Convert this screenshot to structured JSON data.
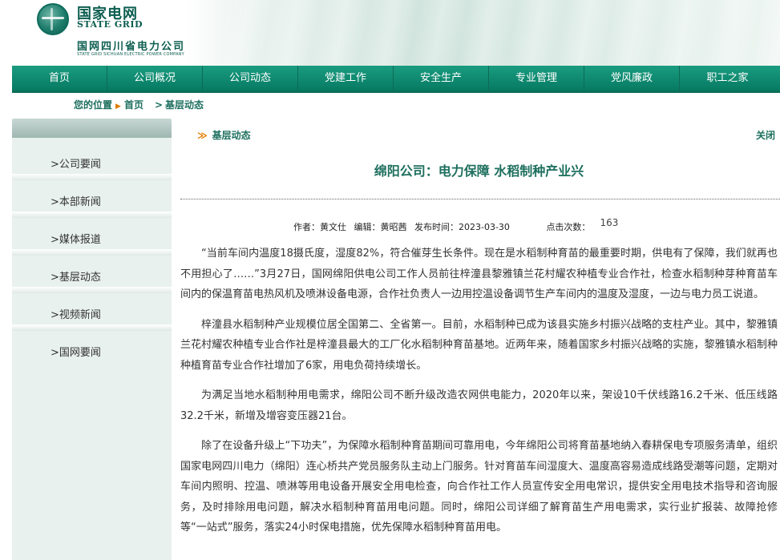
{
  "header": {
    "logo_cn": "国家电网",
    "logo_en": "STATE GRID",
    "company_name": "国网四川省电力公司",
    "company_en": "STATE GRID SICHUAN ELECTRIC POWER COMPANY"
  },
  "nav": [
    "首页",
    "公司概况",
    "公司动态",
    "党建工作",
    "安全生产",
    "专业管理",
    "党风廉政",
    "职工之家"
  ],
  "breadcrumb": {
    "label": "您的位置",
    "home": "首页",
    "current": "基层动态"
  },
  "sidebar": [
    "公司要闻",
    "本部新闻",
    "媒体报道",
    "基层动态",
    "视频新闻",
    "国网要闻"
  ],
  "section": {
    "title": "基层动态",
    "close": "关闭"
  },
  "article": {
    "title": "绵阳公司：电力保障 水稻制种产业兴",
    "author": "作者：黄文仕",
    "editor": "编辑：黄昭茜",
    "date": "发布时间：2023-03-30",
    "views_label": "点击次数：",
    "views": "163",
    "paragraphs": [
      "“当前车间内温度18摄氏度，湿度82%，符合催芽生长条件。现在是水稻制种育苗的最重要时期，供电有了保障，我们就再也不用担心了……”3月27日，国网绵阳供电公司工作人员前往梓潼县黎雅镇兰花村耀农种植专业合作社，检查水稻制种芽种育苗车间内的保温育苗电热风机及喷淋设备电源，合作社负责人一边用控温设备调节生产车间内的温度及湿度，一边与电力员工说道。",
      "梓潼县水稻制种产业规模位居全国第二、全省第一。目前，水稻制种已成为该县实施乡村振兴战略的支柱产业。其中，黎雅镇兰花村耀农种植专业合作社是梓潼县最大的工厂化水稻制种育苗基地。近两年来，随着国家乡村振兴战略的实施，黎雅镇水稻制种种植育苗专业合作社增加了6家，用电负荷持续增长。",
      "为满足当地水稻制种用电需求，绵阳公司不断升级改造农网供电能力，2020年以来，架设10千伏线路16.2千米、低压线路32.2千米，新增及增容变压器21台。",
      "除了在设备升级上“下功夫”，为保障水稻制种育苗期间可靠用电，今年绵阳公司将育苗基地纳入春耕保电专项服务清单，组织国家电网四川电力（绵阳）连心桥共产党员服务队主动上门服务。针对育苗车间湿度大、温度高容易造成线路受潮等问题，定期对车间内照明、控温、喷淋等用电设备开展安全用电检查，向合作社工作人员宣传安全用电常识，提供安全用电技术指导和咨询服务，及时排除用电问题，解决水稻制种育苗用电问题。同时，绵阳公司详细了解育苗生产用电需求，实行业扩报装、故障抢修等“一站式”服务，落实24小时保电措施，优先保障水稻制种育苗用电。"
    ]
  }
}
